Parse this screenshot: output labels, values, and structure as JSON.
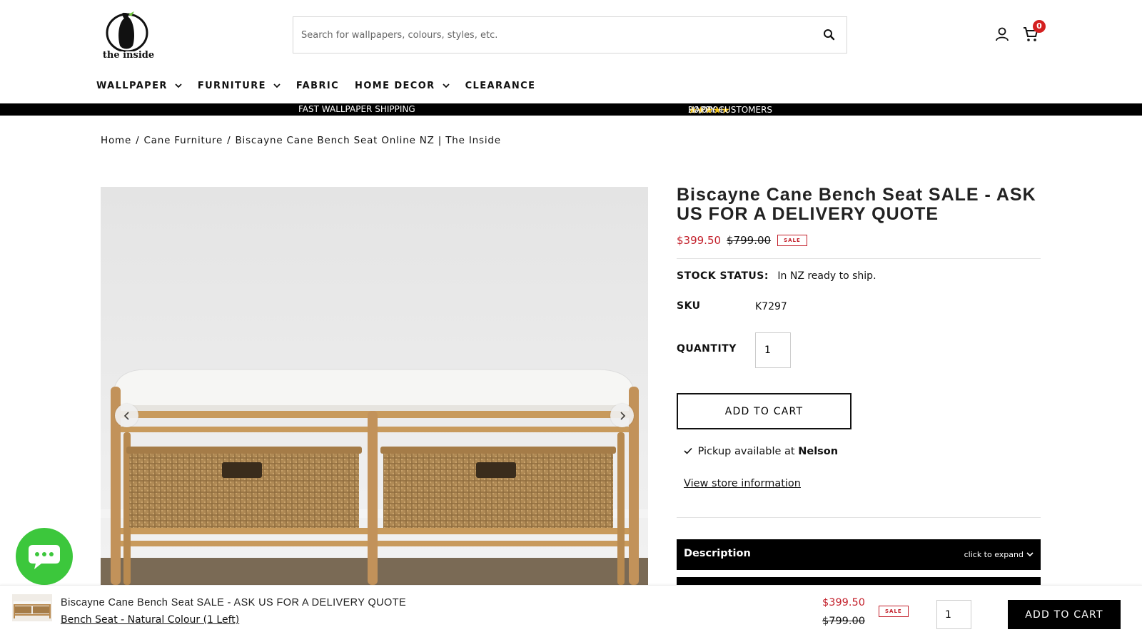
{
  "header": {
    "logo_text": "the inside",
    "search_placeholder": "Search for wallpapers, colours, styles, etc.",
    "cart_count": "0",
    "icons": [
      "search-icon",
      "account-icon",
      "cart-icon"
    ]
  },
  "nav": {
    "items": [
      {
        "label": "WALLPAPER",
        "has_dropdown": true
      },
      {
        "label": "FURNITURE",
        "has_dropdown": true
      },
      {
        "label": "FABRIC",
        "has_dropdown": false
      },
      {
        "label": "HOME DECOR",
        "has_dropdown": true
      },
      {
        "label": "CLEARANCE",
        "has_dropdown": false
      }
    ]
  },
  "promo": {
    "left": "FAST WALLPAPER SHIPPING",
    "right_prefix": "20,000+",
    "right_stars": "★★★★★",
    "right_suffix": "HAPPY CUSTOMERS"
  },
  "breadcrumb": {
    "items": [
      "Home",
      "Cane Furniture",
      "Biscayne Cane Bench Seat Online NZ | The Inside"
    ],
    "separator": "/"
  },
  "product": {
    "title": "Biscayne Cane Bench Seat SALE - ASK US FOR A DELIVERY QUOTE",
    "price_sale": "$399.50",
    "price_old": "$799.00",
    "sale_badge": "SALE",
    "stock_label": "STOCK STATUS:",
    "stock_value": "In NZ ready to ship.",
    "sku_label": "SKU",
    "sku_value": "K7297",
    "quantity_label": "QUANTITY",
    "quantity_value": "1",
    "add_to_cart": "ADD TO CART",
    "pickup_prefix": "Pickup available at",
    "pickup_location": "Nelson",
    "store_link": "View store information",
    "description_label": "Description",
    "description_hint": "click to expand"
  },
  "sticky": {
    "title": "Biscayne Cane Bench Seat SALE - ASK US FOR A DELIVERY QUOTE",
    "variant": "Bench Seat - Natural Colour (1 Left)",
    "price_sale": "$399.50",
    "price_old": "$799.00",
    "sale_badge": "SALE",
    "quantity_value": "1",
    "add_to_cart": "ADD TO CART"
  },
  "colors": {
    "sale_red": "#c3202b",
    "cart_badge": "#d42020",
    "chat_green": "#3cc73c",
    "black": "#000000"
  }
}
